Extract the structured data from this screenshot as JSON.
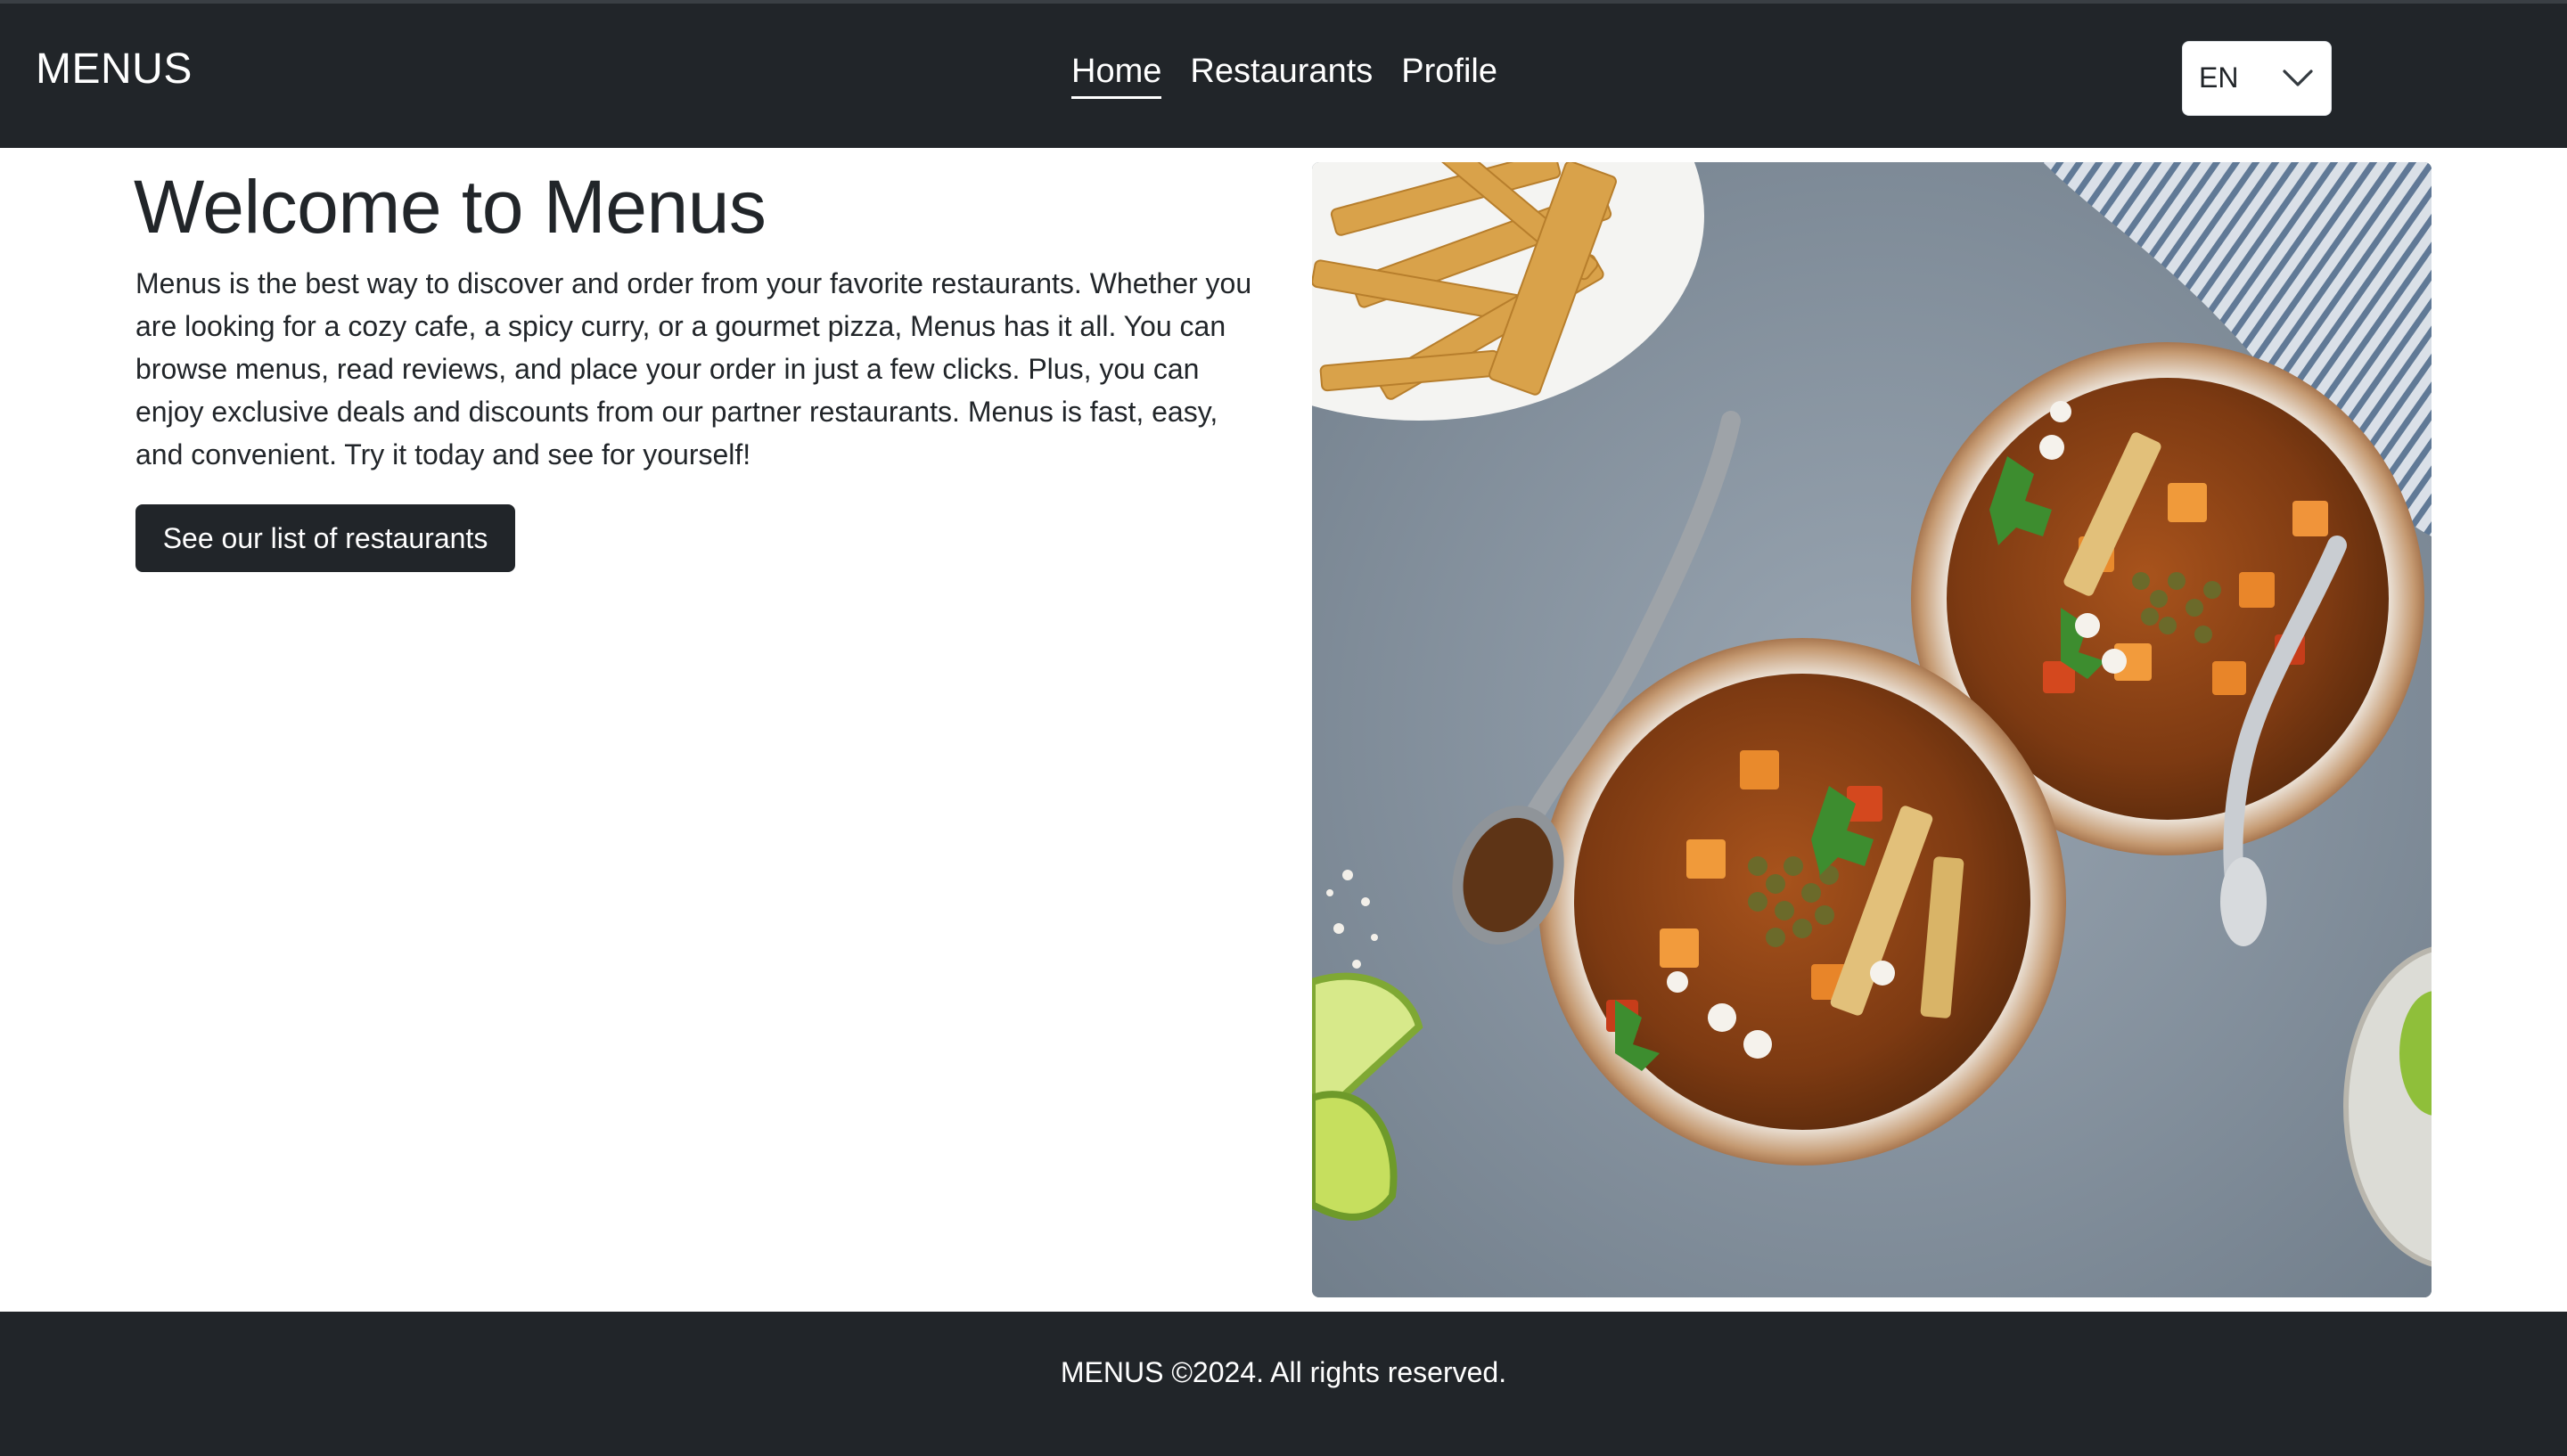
{
  "navbar": {
    "brand": "MENUS",
    "links": [
      {
        "label": "Home",
        "active": true
      },
      {
        "label": "Restaurants",
        "active": false
      },
      {
        "label": "Profile",
        "active": false
      }
    ],
    "language": {
      "selected": "EN",
      "icon": "chevron-down-icon"
    }
  },
  "main": {
    "title": "Welcome to Menus",
    "description": "Menus is the best way to discover and order from your favorite restaurants. Whether you are looking for a cozy cafe, a spicy curry, or a gourmet pizza, Menus has it all. You can browse menus, read reviews, and place your order in just a few clicks. Plus, you can enjoy exclusive deals and discounts from our partner restaurants. Menus is fast, easy, and convenient. Try it today and see for yourself!",
    "cta_label": "See our list of restaurants"
  },
  "footer": {
    "text": "MENUS ©2024. All rights reserved."
  },
  "colors": {
    "dark": "#212529",
    "light": "#ffffff"
  }
}
